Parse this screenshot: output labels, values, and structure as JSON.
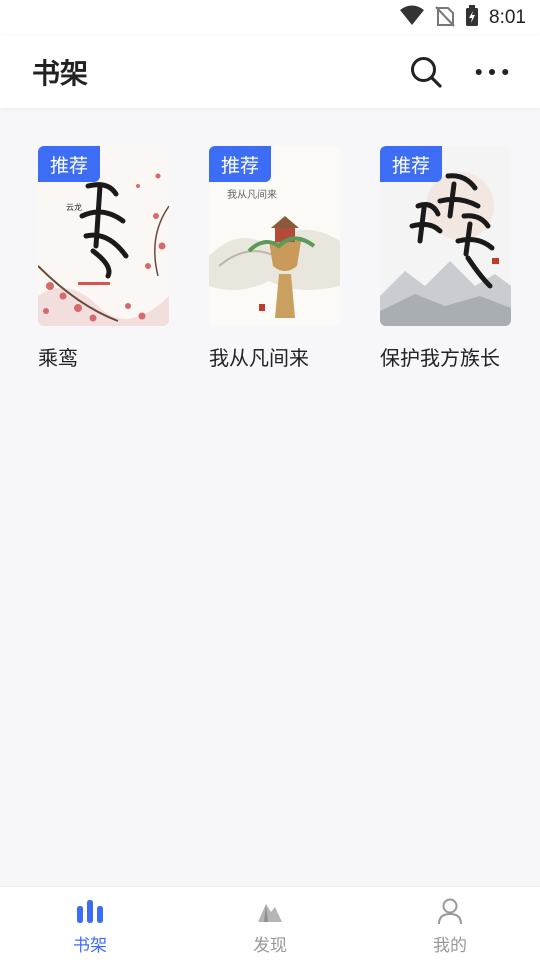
{
  "status_bar": {
    "time": "8:01"
  },
  "header": {
    "title": "书架"
  },
  "colors": {
    "accent": "#3d6df5",
    "inactive": "#999999",
    "background": "#f7f7fa"
  },
  "books": [
    {
      "title": "乘鸾",
      "badge": "推荐"
    },
    {
      "title": "我从凡间来",
      "badge": "推荐"
    },
    {
      "title": "保护我方族长",
      "badge": "推荐"
    }
  ],
  "bottom_nav": {
    "items": [
      {
        "label": "书架",
        "icon": "bookshelf-icon",
        "active": true
      },
      {
        "label": "发现",
        "icon": "discover-icon",
        "active": false
      },
      {
        "label": "我的",
        "icon": "profile-icon",
        "active": false
      }
    ]
  }
}
